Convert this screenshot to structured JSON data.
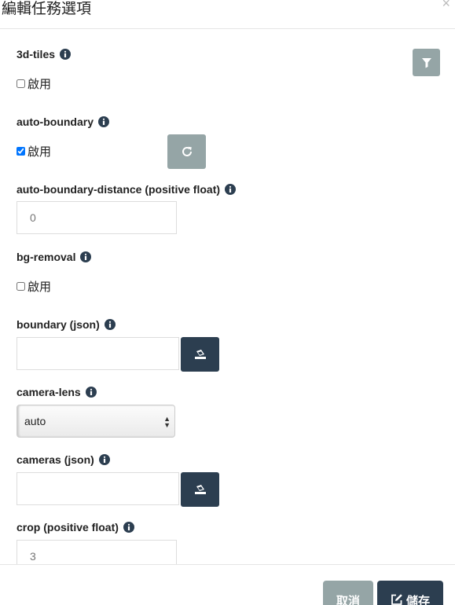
{
  "dialog": {
    "title": "編輯任務選項"
  },
  "icons": {
    "close": "×"
  },
  "options": {
    "tiles3d": {
      "label": "3d-tiles",
      "checkbox_label": "啟用",
      "checked": false
    },
    "auto_boundary": {
      "label": "auto-boundary",
      "checkbox_label": "啟用",
      "checked": true
    },
    "auto_boundary_distance": {
      "label": "auto-boundary-distance (positive float)",
      "placeholder": "0"
    },
    "bg_removal": {
      "label": "bg-removal",
      "checkbox_label": "啟用",
      "checked": false
    },
    "boundary": {
      "label": "boundary (json)",
      "value": ""
    },
    "camera_lens": {
      "label": "camera-lens",
      "selected": "auto"
    },
    "cameras": {
      "label": "cameras (json)",
      "value": ""
    },
    "crop": {
      "label": "crop (positive float)",
      "placeholder": "3"
    }
  },
  "footer": {
    "cancel_label": "取消",
    "save_label": "儲存"
  },
  "colors": {
    "dark_button": "#2c3e50",
    "gray_button": "#95a5a6",
    "info_icon": "#2c3e50"
  }
}
